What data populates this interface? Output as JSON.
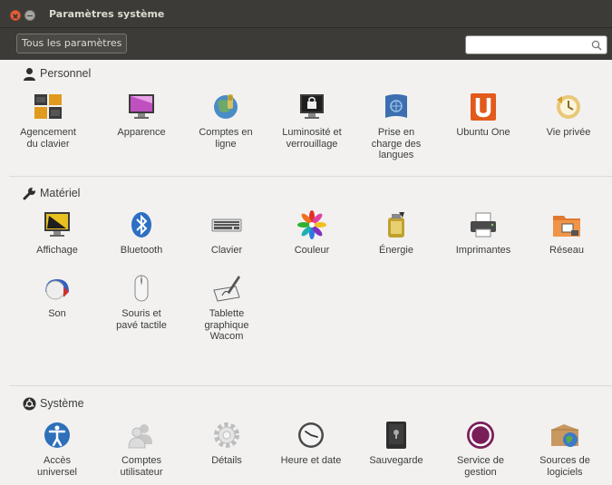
{
  "window": {
    "title": "Paramètres système"
  },
  "toolbar": {
    "all_settings_label": "Tous les paramètres",
    "search_value": "",
    "search_placeholder": ""
  },
  "sections": [
    {
      "title": "Personnel",
      "icon": "person-icon",
      "items": [
        {
          "name": "item-agencement",
          "icon": "keyboard-layout-icon",
          "lines": [
            "Agencement",
            "du clavier"
          ]
        },
        {
          "name": "item-apparence",
          "icon": "appearance-icon",
          "lines": [
            "Apparence"
          ]
        },
        {
          "name": "item-comptes-en-ligne",
          "icon": "online-accounts-icon",
          "lines": [
            "Comptes en",
            "ligne"
          ]
        },
        {
          "name": "item-luminosite",
          "icon": "brightness-lock-icon",
          "lines": [
            "Luminosité et",
            "verrouillage"
          ]
        },
        {
          "name": "item-langues",
          "icon": "language-support-icon",
          "lines": [
            "Prise en",
            "charge des",
            "langues"
          ]
        },
        {
          "name": "item-ubuntu-one",
          "icon": "ubuntu-one-icon",
          "lines": [
            "Ubuntu One"
          ]
        },
        {
          "name": "item-vie-privee",
          "icon": "privacy-icon",
          "lines": [
            "Vie privée"
          ]
        }
      ]
    },
    {
      "title": "Matériel",
      "icon": "wrench-icon",
      "items": [
        {
          "name": "item-affichage",
          "icon": "display-icon",
          "lines": [
            "Affichage"
          ]
        },
        {
          "name": "item-bluetooth",
          "icon": "bluetooth-icon",
          "lines": [
            "Bluetooth"
          ]
        },
        {
          "name": "item-clavier",
          "icon": "keyboard-icon",
          "lines": [
            "Clavier"
          ]
        },
        {
          "name": "item-couleur",
          "icon": "color-icon",
          "lines": [
            "Couleur"
          ]
        },
        {
          "name": "item-energie",
          "icon": "power-icon",
          "lines": [
            "Énergie"
          ]
        },
        {
          "name": "item-imprimantes",
          "icon": "printer-icon",
          "lines": [
            "Imprimantes"
          ]
        },
        {
          "name": "item-reseau",
          "icon": "network-icon",
          "lines": [
            "Réseau"
          ]
        },
        {
          "name": "item-son",
          "icon": "sound-icon",
          "lines": [
            "Son"
          ]
        },
        {
          "name": "item-souris",
          "icon": "mouse-icon",
          "lines": [
            "Souris et",
            "pavé tactile"
          ]
        },
        {
          "name": "item-wacom",
          "icon": "tablet-icon",
          "lines": [
            "Tablette",
            "graphique",
            "Wacom"
          ]
        }
      ]
    },
    {
      "title": "Système",
      "icon": "system-gear-icon",
      "items": [
        {
          "name": "item-acces-universel",
          "icon": "universal-access-icon",
          "lines": [
            "Accès",
            "universel"
          ]
        },
        {
          "name": "item-comptes-utilisateur",
          "icon": "user-accounts-icon",
          "lines": [
            "Comptes",
            "utilisateur"
          ]
        },
        {
          "name": "item-details",
          "icon": "details-gear-icon",
          "lines": [
            "Détails"
          ]
        },
        {
          "name": "item-heure-date",
          "icon": "clock-icon",
          "lines": [
            "Heure et date"
          ]
        },
        {
          "name": "item-sauvegarde",
          "icon": "backup-safe-icon",
          "lines": [
            "Sauvegarde"
          ]
        },
        {
          "name": "item-service-gestion",
          "icon": "management-service-icon",
          "lines": [
            "Service de",
            "gestion"
          ]
        },
        {
          "name": "item-sources-logiciels",
          "icon": "software-sources-icon",
          "lines": [
            "Sources de",
            "logiciels"
          ]
        }
      ]
    }
  ]
}
